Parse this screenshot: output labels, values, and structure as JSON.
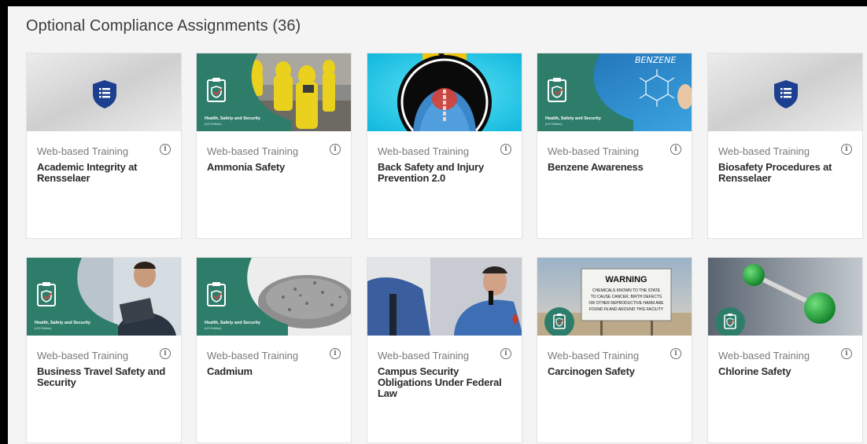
{
  "page": {
    "title": "Optional Compliance Assignments (36)"
  },
  "colors": {
    "brand_teal": "#2e7d6b",
    "navy_badge": "#1d3f8f"
  },
  "banner_text": {
    "hss": "Health, Safety and Security",
    "edition": "(US Edition)",
    "benzene": "BENZENE",
    "warning_title": "WARNING",
    "warning_lines": [
      "CHEMICALS KNOWN TO THE STATE",
      "TO CAUSE CANCER, BIRTH DEFECTS",
      "OR OTHER REPRODUCTIVE HARM ARE",
      "FOUND IN AND AROUND THIS FACILITY"
    ]
  },
  "cards": [
    {
      "type": "Web-based Training",
      "title": "Academic Integrity at Rensselaer",
      "icon": "shield-list-icon"
    },
    {
      "type": "Web-based Training",
      "title": "Ammonia Safety",
      "icon": "clipboard-shield-icon"
    },
    {
      "type": "Web-based Training",
      "title": "Back Safety and Injury Prevention 2.0",
      "icon": "spine-xray-image"
    },
    {
      "type": "Web-based Training",
      "title": "Benzene Awareness",
      "icon": "clipboard-shield-icon"
    },
    {
      "type": "Web-based Training",
      "title": "Biosafety Procedures at Rensselaer",
      "icon": "shield-list-icon"
    },
    {
      "type": "Web-based Training",
      "title": "Business Travel Safety and Security",
      "icon": "clipboard-shield-icon"
    },
    {
      "type": "Web-based Training",
      "title": "Cadmium",
      "icon": "clipboard-shield-icon"
    },
    {
      "type": "Web-based Training",
      "title": "Campus Security Obligations Under Federal Law",
      "icon": "security-officer-image"
    },
    {
      "type": "Web-based Training",
      "title": "Carcinogen Safety",
      "icon": "clipboard-shield-icon"
    },
    {
      "type": "Web-based Training",
      "title": "Chlorine Safety",
      "icon": "clipboard-shield-icon"
    }
  ],
  "info_glyph": "i"
}
